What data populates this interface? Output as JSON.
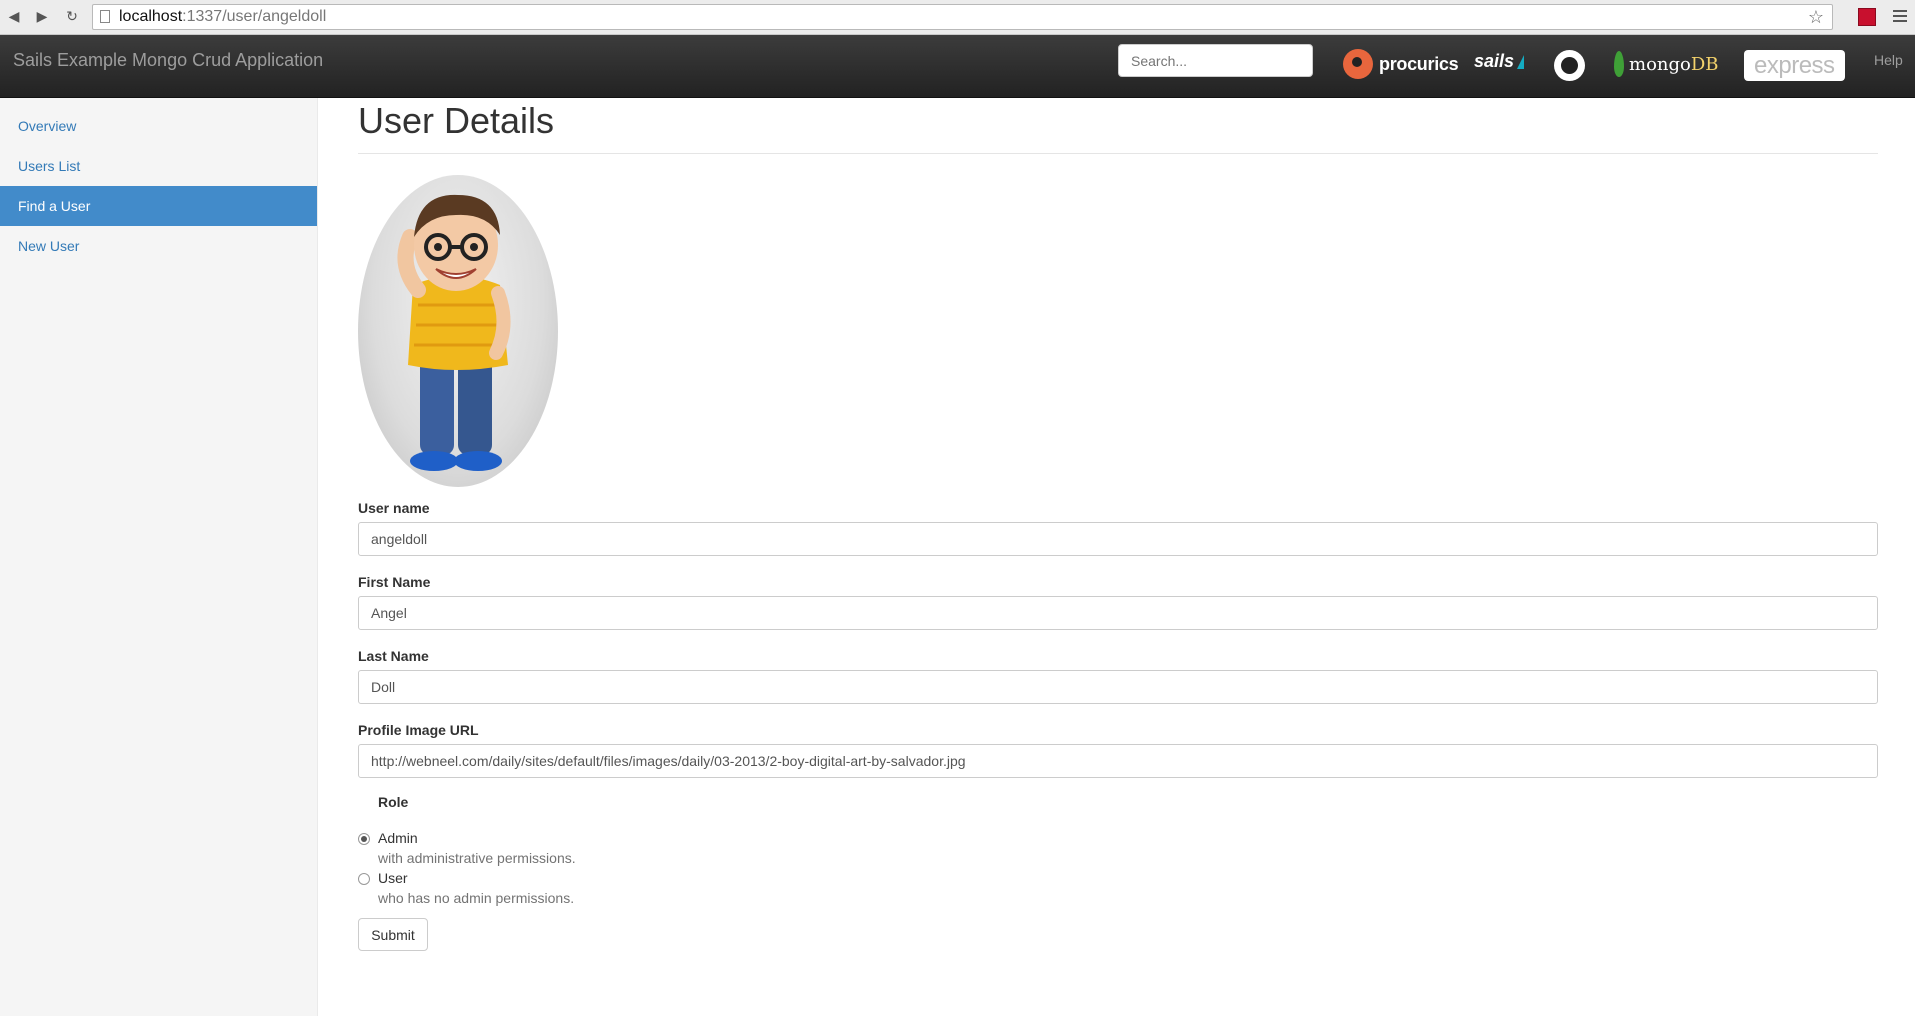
{
  "browser": {
    "url_host": "localhost",
    "url_path": ":1337/user/angeldoll"
  },
  "navbar": {
    "brand": "Sails Example Mongo Crud Application",
    "search_placeholder": "Search...",
    "logos": {
      "procurics": "procurics",
      "sails": "sails",
      "mongo_main": "mongo",
      "mongo_db": "DB",
      "express": "express"
    },
    "help": "Help"
  },
  "sidebar": {
    "items": [
      {
        "label": "Overview",
        "active": false
      },
      {
        "label": "Users List",
        "active": false
      },
      {
        "label": "Find a User",
        "active": true
      },
      {
        "label": "New User",
        "active": false
      }
    ]
  },
  "main": {
    "title": "User Details",
    "fields": {
      "username": {
        "label": "User name",
        "value": "angeldoll"
      },
      "first_name": {
        "label": "First Name",
        "value": "Angel"
      },
      "last_name": {
        "label": "Last Name",
        "value": "Doll"
      },
      "profile_image_url": {
        "label": "Profile Image URL",
        "value": "http://webneel.com/daily/sites/default/files/images/daily/03-2013/2-boy-digital-art-by-salvador.jpg"
      }
    },
    "role": {
      "label": "Role",
      "options": [
        {
          "label": "Admin",
          "help": "with administrative permissions.",
          "checked": true
        },
        {
          "label": "User",
          "help": "who has no admin permissions.",
          "checked": false
        }
      ]
    },
    "submit_label": "Submit"
  },
  "colors": {
    "navbar_bg": "#222222",
    "sidebar_active": "#428bca",
    "link": "#337ab7"
  }
}
